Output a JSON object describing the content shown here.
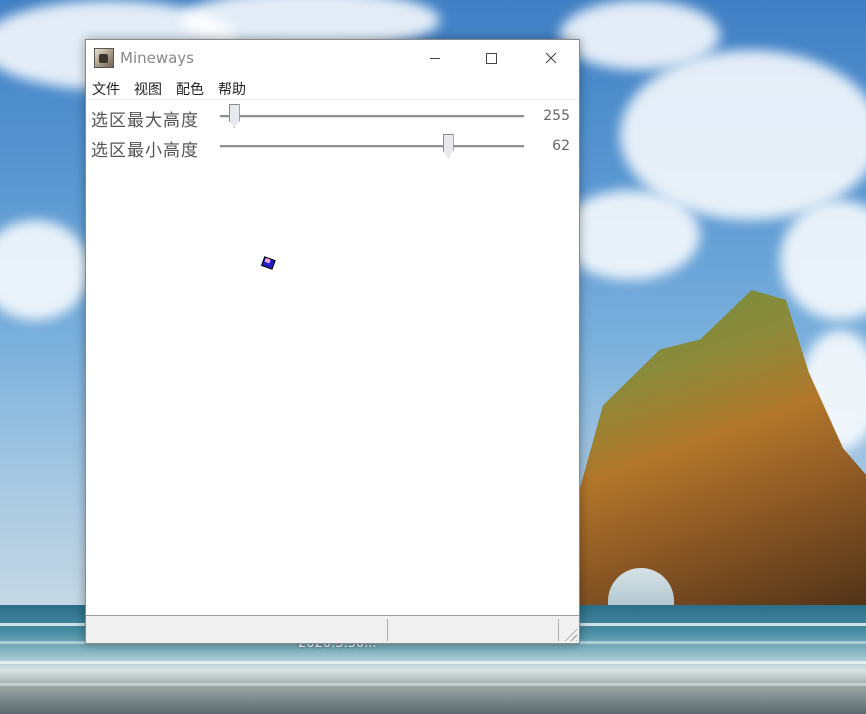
{
  "window": {
    "title": "Mineways",
    "icons": {
      "app": "mineways-app-icon",
      "minimize": "minimize-icon",
      "maximize": "maximize-icon",
      "close": "close-icon"
    }
  },
  "menu": {
    "items": [
      {
        "label": "文件"
      },
      {
        "label": "视图"
      },
      {
        "label": "配色"
      },
      {
        "label": "帮助"
      }
    ]
  },
  "sliders": {
    "max_height": {
      "label": "选区最大高度",
      "value": "255",
      "position_fraction": 0.03
    },
    "min_height": {
      "label": "选区最小高度",
      "value": "62",
      "position_fraction": 0.76
    }
  },
  "status_bar": {
    "panes": [
      "",
      ""
    ]
  },
  "desktop": {
    "label": "2020.3.30..."
  },
  "colors": {
    "window_bg": "#ffffff",
    "accent": "#2020c8",
    "titlebar_text": "#888888"
  }
}
